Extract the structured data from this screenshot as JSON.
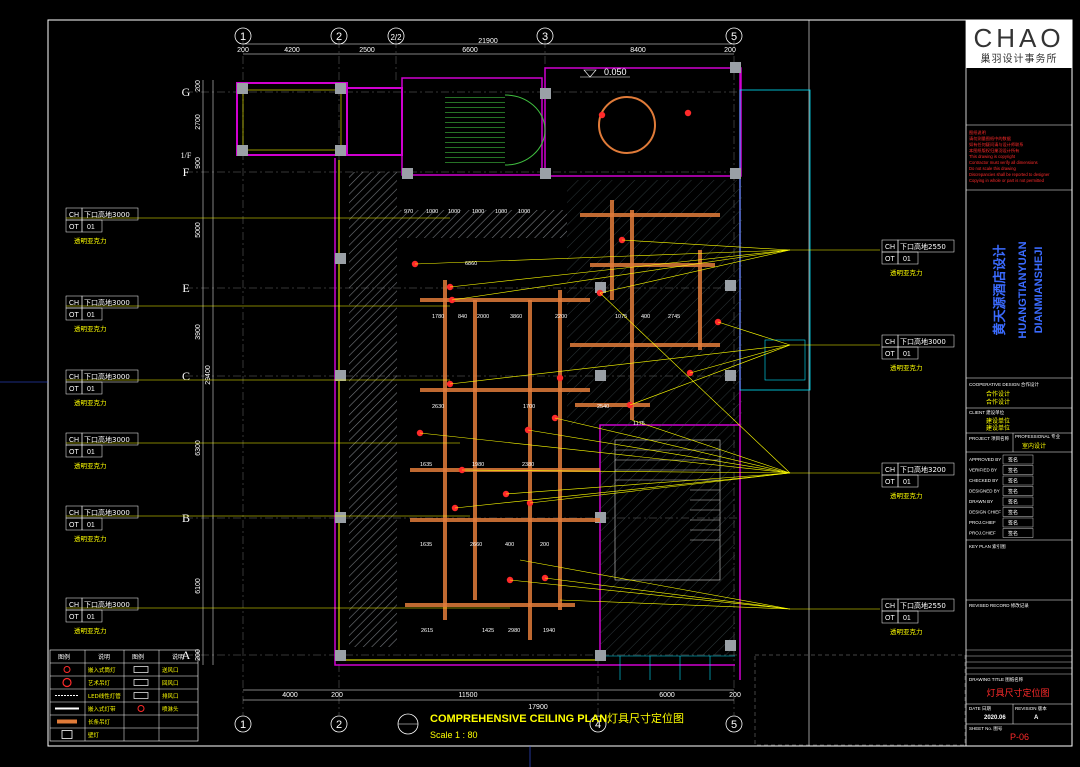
{
  "brand": {
    "logo_text": "CHAO",
    "logo_sub": "巢羽设计事务所",
    "logo_accent": "#e8722a"
  },
  "title_block": {
    "vertical_cn": "黄天源酒店设计",
    "vertical_en1": "HUANGTIANYUAN",
    "vertical_en2": "DIANMIANSHEJI",
    "red_notes": [
      "图纸说明",
      "请勿测量图纸中的数据",
      "如有任何疑问请与设计师联系",
      "本图纸版权归巢羽设计所有",
      "This drawing is copyright",
      "Contractor must verify all dimensions",
      "Do not scale this drawing",
      "Discrepancies shall be reported to designer",
      "Copying in whole or part is not permitted"
    ],
    "cooperative_label": "COOPERATIVE DESIGN  合作设计",
    "cooperative_cn_1": "合作设计",
    "cooperative_cn_2": "合作设计",
    "client_label": "CLIENT 建设单位",
    "client_cn_1": "建设单位",
    "client_cn_2": "建设单位",
    "project_label": "PROJECT 项目名称",
    "professional_label": "PROFESSIONAL 专业",
    "professional_value": "室内设计",
    "sign_rows": [
      {
        "label": "APPROVED BY",
        "value": "签名"
      },
      {
        "label": "VERIFIED BY",
        "value": "签名"
      },
      {
        "label": "CHECKED BY",
        "value": "签名"
      },
      {
        "label": "DESIGNED BY",
        "value": "签名"
      },
      {
        "label": "DRAWN BY",
        "value": "签名"
      },
      {
        "label": "DESIGN CHIEF",
        "value": "签名"
      },
      {
        "label": "PROJ.CHIEF",
        "value": "签名"
      },
      {
        "label": "PROJ.CHIEF",
        "value": "签名"
      }
    ],
    "key_plan_label": "KEY PLAN 索引图",
    "revised_label": "REVISED RECORD 修改记录",
    "drawing_title_label": "DRAWING TITLE 图纸名称",
    "drawing_title": "灯具尺寸定位图",
    "date_label": "DATE 日期",
    "date_value": "2020.06",
    "revision_label": "REVISION 版本",
    "revision_value": "A",
    "sheet_label": "SHEET No. 图号",
    "sheet_value": "P-06"
  },
  "drawing": {
    "title_en": "COMPREHENSIVE CEILING PLAN",
    "title_cn": "灯具尺寸定位图",
    "scale": "Scale 1 : 80",
    "level": "0.050",
    "col_labels": [
      "1",
      "2",
      "2/2",
      "3",
      "4",
      "5"
    ],
    "row_labels": [
      "G",
      "1/F",
      "F",
      "E",
      "C",
      "B",
      "A"
    ],
    "top_total": "21900",
    "top_dims": [
      "200",
      "4200",
      "2500",
      "6600",
      "8400",
      "200"
    ],
    "bottom_total": "17900",
    "bottom_dims": [
      "4000",
      "200",
      "11500",
      "6000",
      "200"
    ],
    "left_total": "29400",
    "left_dims": [
      "200",
      "2700",
      "900",
      "5000",
      "3900",
      "6300",
      "6100",
      "200"
    ]
  },
  "tags_left": [
    {
      "ch": "CH",
      "height": "下口高地3000",
      "ot": "OT",
      "num": "01",
      "desc": "透明亚克力"
    },
    {
      "ch": "CH",
      "height": "下口高地3000",
      "ot": "OT",
      "num": "01",
      "desc": "透明亚克力"
    },
    {
      "ch": "CH",
      "height": "下口高地3000",
      "ot": "OT",
      "num": "01",
      "desc": "透明亚克力"
    },
    {
      "ch": "CH",
      "height": "下口高地3000",
      "ot": "OT",
      "num": "01",
      "desc": "透明亚克力"
    },
    {
      "ch": "CH",
      "height": "下口高地3000",
      "ot": "OT",
      "num": "01",
      "desc": "透明亚克力"
    },
    {
      "ch": "CH",
      "height": "下口高地3000",
      "ot": "OT",
      "num": "01",
      "desc": "透明亚克力"
    }
  ],
  "tags_right": [
    {
      "ch": "CH",
      "height": "下口高地2550",
      "ot": "OT",
      "num": "01",
      "desc": "透明亚克力"
    },
    {
      "ch": "CH",
      "height": "下口高地3000",
      "ot": "OT",
      "num": "01",
      "desc": "透明亚克力"
    },
    {
      "ch": "CH",
      "height": "下口高地3200",
      "ot": "OT",
      "num": "01",
      "desc": "透明亚克力"
    },
    {
      "ch": "CH",
      "height": "下口高地2550",
      "ot": "OT",
      "num": "01",
      "desc": "透明亚克力"
    }
  ],
  "legend": {
    "headers": [
      "图例",
      "说明",
      "图例",
      "说明"
    ],
    "rows": [
      [
        "嵌入式筒灯",
        "送风口"
      ],
      [
        "艺术吊灯",
        "回风口"
      ],
      [
        "LED线性灯管",
        "排风口"
      ],
      [
        "嵌入式灯带",
        "喷淋头"
      ],
      [
        "长条吊灯",
        ""
      ],
      [
        "壁灯",
        ""
      ]
    ]
  },
  "dim_samples": [
    "970",
    "1000",
    "1000",
    "1000",
    "1000",
    "1000",
    "6860",
    "1780",
    "840",
    "2000",
    "3860",
    "2200",
    "1075",
    "400",
    "2745",
    "2630",
    "1700",
    "2540",
    "1175",
    "1635",
    "1980",
    "2380",
    "1635",
    "2660",
    "2615",
    "1940",
    "1425",
    "2980",
    "400",
    "200"
  ],
  "colors": {
    "background": "#000000",
    "frame": "#ffffff",
    "lead_line": "#ffff00",
    "dimension": "#ffffff",
    "wall_magenta": "#d000d0",
    "hatch": "#9aa0a6",
    "cyan": "#00e5ff",
    "orange_beam": "#e07b39",
    "grid_blue": "#3b5bff",
    "title_red": "#ff2a2a",
    "title_blue": "#3b6bff"
  }
}
